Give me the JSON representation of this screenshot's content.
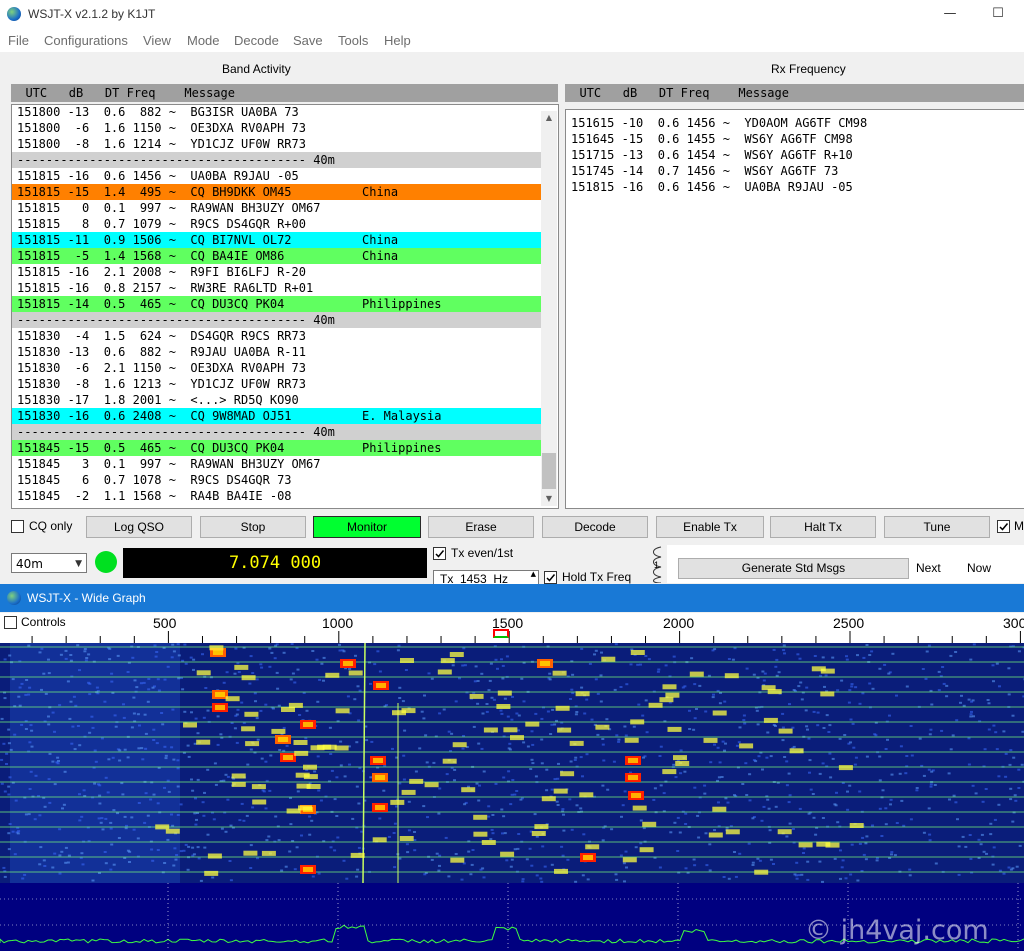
{
  "window": {
    "title": "WSJT-X   v2.1.2   by K1JT",
    "minimize": "—",
    "maximize": "☐"
  },
  "menu": [
    "File",
    "Configurations",
    "View",
    "Mode",
    "Decode",
    "Save",
    "Tools",
    "Help"
  ],
  "band_activity": {
    "title": "Band Activity",
    "header": "  UTC   dB   DT Freq    Message",
    "rows": [
      {
        "text": "151800 -13  0.6  882 ~  BG3ISR UA0BA 73",
        "country": "",
        "style": ""
      },
      {
        "text": "151800  -6  1.6 1150 ~  OE3DXA RV0APH 73",
        "country": "",
        "style": ""
      },
      {
        "text": "151800  -8  1.6 1214 ~  YD1CJZ UF0W RR73",
        "country": "",
        "style": ""
      },
      {
        "text": "---------------------------------------- 40m",
        "country": "",
        "style": "sep"
      },
      {
        "text": "151815 -16  0.6 1456 ~  UA0BA R9JAU -05",
        "country": "",
        "style": ""
      },
      {
        "text": "151815 -15  1.4  495 ~  CQ BH9DKK OM45",
        "country": "China",
        "style": "orange"
      },
      {
        "text": "151815   0  0.1  997 ~  RA9WAN BH3UZY OM67",
        "country": "",
        "style": ""
      },
      {
        "text": "151815   8  0.7 1079 ~  R9CS DS4GQR R+00",
        "country": "",
        "style": ""
      },
      {
        "text": "151815 -11  0.9 1506 ~  CQ BI7NVL OL72",
        "country": "China",
        "style": "cyan"
      },
      {
        "text": "151815  -5  1.4 1568 ~  CQ BA4IE OM86",
        "country": "China",
        "style": "green"
      },
      {
        "text": "151815 -16  2.1 2008 ~  R9FI BI6LFJ R-20",
        "country": "",
        "style": ""
      },
      {
        "text": "151815 -16  0.8 2157 ~  RW3RE RA6LTD R+01",
        "country": "",
        "style": ""
      },
      {
        "text": "151815 -14  0.5  465 ~  CQ DU3CQ PK04",
        "country": "Philippines",
        "style": "green"
      },
      {
        "text": "---------------------------------------- 40m",
        "country": "",
        "style": "sep"
      },
      {
        "text": "151830  -4  1.5  624 ~  DS4GQR R9CS RR73",
        "country": "",
        "style": ""
      },
      {
        "text": "151830 -13  0.6  882 ~  R9JAU UA0BA R-11",
        "country": "",
        "style": ""
      },
      {
        "text": "151830  -6  2.1 1150 ~  OE3DXA RV0APH 73",
        "country": "",
        "style": ""
      },
      {
        "text": "151830  -8  1.6 1213 ~  YD1CJZ UF0W RR73",
        "country": "",
        "style": ""
      },
      {
        "text": "151830 -17  1.8 2001 ~  <...> RD5Q KO90",
        "country": "",
        "style": ""
      },
      {
        "text": "151830 -16  0.6 2408 ~  CQ 9W8MAD OJ51",
        "country": "E. Malaysia",
        "style": "cyan"
      },
      {
        "text": "---------------------------------------- 40m",
        "country": "",
        "style": "sep"
      },
      {
        "text": "151845 -15  0.5  465 ~  CQ DU3CQ PK04",
        "country": "Philippines",
        "style": "green"
      },
      {
        "text": "151845   3  0.1  997 ~  RA9WAN BH3UZY OM67",
        "country": "",
        "style": ""
      },
      {
        "text": "151845   6  0.7 1078 ~  R9CS DS4GQR 73",
        "country": "",
        "style": ""
      },
      {
        "text": "151845  -2  1.1 1568 ~  RA4B BA4IE -08",
        "country": "",
        "style": ""
      }
    ]
  },
  "rx_frequency": {
    "title": "Rx Frequency",
    "header": "  UTC   dB   DT Freq    Message",
    "rows": [
      "151615 -10  0.6 1456 ~  YD0AOM AG6TF CM98",
      "151645 -15  0.6 1455 ~  WS6Y AG6TF CM98",
      "151715 -13  0.6 1454 ~  WS6Y AG6TF R+10",
      "151745 -14  0.7 1456 ~  WS6Y AG6TF 73",
      "151815 -16  0.6 1456 ~  UA0BA R9JAU -05"
    ]
  },
  "controls": {
    "cq_only": "CQ only",
    "log_qso": "Log QSO",
    "stop": "Stop",
    "monitor": "Monitor",
    "erase": "Erase",
    "decode": "Decode",
    "enable_tx": "Enable Tx",
    "halt_tx": "Halt Tx",
    "tune": "Tune",
    "menus_cb": "M"
  },
  "status": {
    "band": "40m",
    "dial_freq": "7.074 000",
    "tx_even": "Tx even/1st",
    "tx_freq": "Tx  1453  Hz",
    "hold_tx": "Hold Tx Freq",
    "gen_msgs": "Generate Std Msgs",
    "next": "Next",
    "now": "Now",
    "tab_label": "1"
  },
  "wide_graph": {
    "title": "WSJT-X - Wide Graph",
    "controls": "Controls",
    "ticks": [
      "500",
      "1000",
      "1500",
      "2000",
      "2500",
      "300"
    ],
    "watermark": "© jh4vaj.com"
  },
  "colors": {
    "orange": "#ff8000",
    "cyan": "#00ffff",
    "green": "#60ff60",
    "sep": "#d0d0d0",
    "monitor": "#00ff30",
    "wg_title": "#1979d6",
    "dial_text": "#ffff00"
  }
}
